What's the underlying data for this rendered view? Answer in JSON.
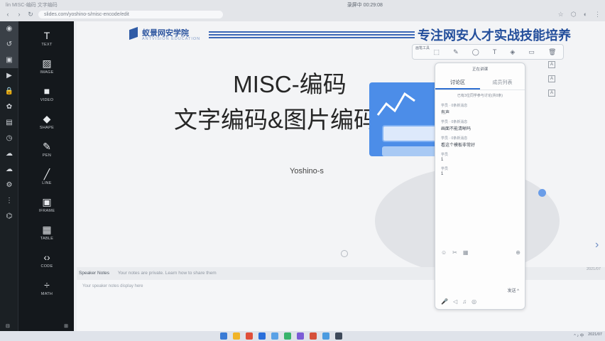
{
  "browser": {
    "tab_title": "lin MISC-编码 文字编码",
    "clock": "录屏中 00:29:08",
    "url": "slides.com/yoshino-s/misc-encode/edit",
    "back": "‹",
    "forward": "›",
    "reload": "↻"
  },
  "sidebar_icons": [
    "◉",
    "↺",
    "▣",
    "▶",
    "🔒",
    "✿",
    "▤",
    "◷",
    "☁",
    "☁",
    "⚙",
    "⋮",
    "⌬"
  ],
  "tools": [
    {
      "glyph": "T",
      "label": "TEXT"
    },
    {
      "glyph": "▨",
      "label": "IMAGE"
    },
    {
      "glyph": "■",
      "label": "VIDEO"
    },
    {
      "glyph": "◆",
      "label": "SHAPE"
    },
    {
      "glyph": "✎",
      "label": "PEN"
    },
    {
      "glyph": "╱",
      "label": "LINE"
    },
    {
      "glyph": "▣",
      "label": "IFRAME"
    },
    {
      "glyph": "▦",
      "label": "TABLE"
    },
    {
      "glyph": "‹›",
      "label": "CODE"
    },
    {
      "glyph": "÷",
      "label": "MATH"
    }
  ],
  "left_footer": {
    "zoom": "⊟",
    "grid": "⊞"
  },
  "slide": {
    "logo_name": "蚁景网安学院",
    "logo_sub": "ANTVISION EDUCATION",
    "slogan": "专注网安人才实战技能培养",
    "title_line1": "MISC-编码",
    "title_line2": "文字编码&图片编码",
    "author": "Yoshino-s"
  },
  "notes": {
    "label": "Speaker Notes",
    "placeholder": "Your notes are private. Learn how to share them",
    "body_placeholder": "Your speaker notes display here"
  },
  "qa_panel": {
    "header": "正在讲课",
    "tabs": [
      "讨论区",
      "成员列表"
    ],
    "meta": "已有3位同学参与讨论(共0条)",
    "messages": [
      {
        "who": "学员 · 0条新消息",
        "text": "有声"
      },
      {
        "who": "学员 · 0条新消息",
        "text": "画面不能清晰吗"
      },
      {
        "who": "学员 · 0条新消息",
        "text": "看这个模板非常好"
      },
      {
        "who": "学员",
        "text": "1"
      },
      {
        "who": "学员",
        "text": "1"
      }
    ],
    "input_icons": [
      "☺",
      "✂",
      "▦",
      "⊕"
    ],
    "footer": "发送 ^",
    "bottom_icons": [
      "🎤",
      "◁",
      "♫",
      "◎"
    ]
  },
  "float_toolbar": {
    "title": "画笔工具",
    "icons": [
      "⬚",
      "✎",
      "◯",
      "T",
      "◈",
      "▭",
      "🗑"
    ]
  },
  "right_strip": [
    "A",
    "A",
    "A"
  ],
  "slide_nav": "›",
  "corner_time": "2021/07",
  "taskbar": {
    "tray": "^ ♪ 中",
    "time": "2021/07"
  }
}
